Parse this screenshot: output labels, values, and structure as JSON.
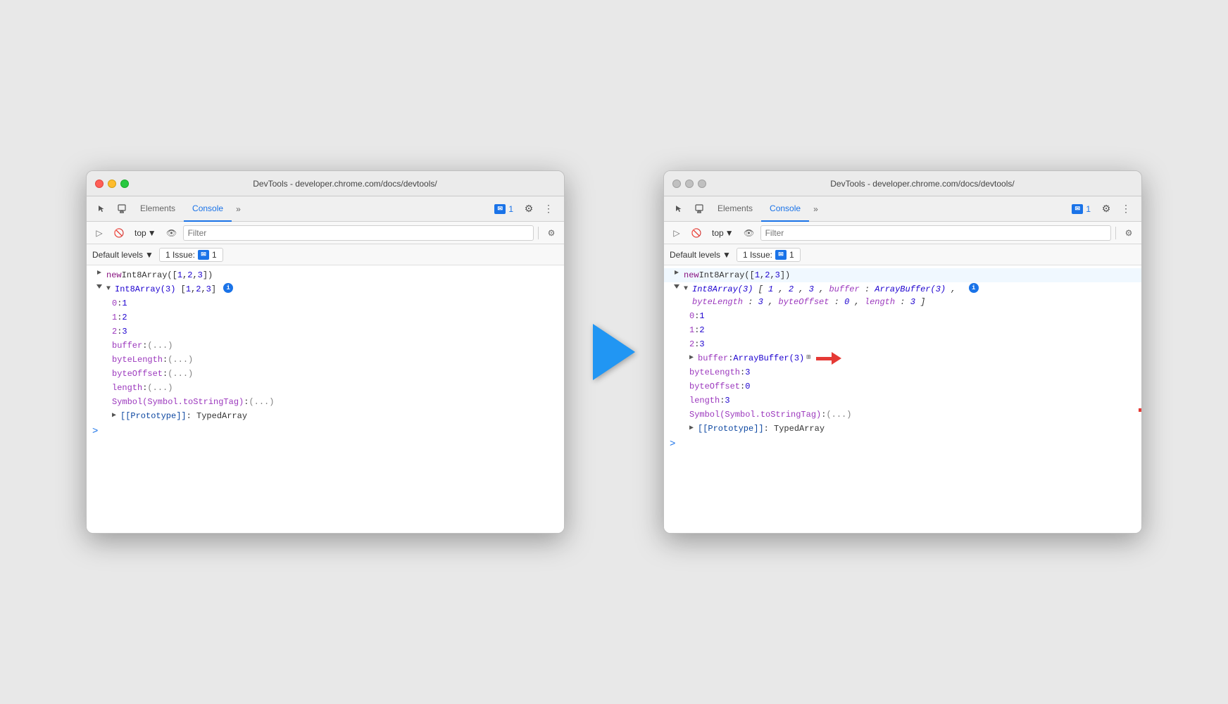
{
  "left_panel": {
    "title": "DevTools - developer.chrome.com/docs/devtools/",
    "tabs": {
      "elements": "Elements",
      "console": "Console",
      "more": "»"
    },
    "badge_count": "1",
    "filter_placeholder": "Filter",
    "default_levels": "Default levels",
    "issues_label": "1 Issue:",
    "issues_count": "1",
    "top_label": "top",
    "console_lines": [
      {
        "type": "input",
        "content": "new Int8Array([1,2,3])"
      },
      {
        "type": "output_header",
        "content": "Int8Array(3) [1, 2, 3]"
      },
      {
        "type": "prop",
        "key": "0",
        "value": "1"
      },
      {
        "type": "prop",
        "key": "1",
        "value": "2"
      },
      {
        "type": "prop",
        "key": "2",
        "value": "3"
      },
      {
        "type": "prop_lazy",
        "key": "buffer",
        "value": "(...)"
      },
      {
        "type": "prop_lazy",
        "key": "byteLength",
        "value": "(...)"
      },
      {
        "type": "prop_lazy",
        "key": "byteOffset",
        "value": "(...)"
      },
      {
        "type": "prop_lazy",
        "key": "length",
        "value": "(...)"
      },
      {
        "type": "prop_symbol",
        "key": "Symbol(Symbol.toStringTag)",
        "value": "(...)"
      },
      {
        "type": "prototype",
        "content": "[[Prototype]]: TypedArray"
      }
    ]
  },
  "right_panel": {
    "title": "DevTools - developer.chrome.com/docs/devtools/",
    "tabs": {
      "elements": "Elements",
      "console": "Console",
      "more": "»"
    },
    "badge_count": "1",
    "filter_placeholder": "Filter",
    "default_levels": "Default levels",
    "issues_label": "1 Issue:",
    "issues_count": "1",
    "top_label": "top",
    "console_lines": [
      {
        "type": "input",
        "content": "new Int8Array([1,2,3])"
      },
      {
        "type": "output_header_expanded",
        "content": "Int8Array(3) [1, 2, 3, buffer: ArrayBuffer(3), byteLength: 3, byteOffset: 0, length: 3]"
      },
      {
        "type": "prop",
        "key": "0",
        "value": "1"
      },
      {
        "type": "prop",
        "key": "1",
        "value": "2"
      },
      {
        "type": "prop",
        "key": "2",
        "value": "3"
      },
      {
        "type": "prop_buffer",
        "key": "buffer",
        "value": "ArrayBuffer(3)"
      },
      {
        "type": "prop_plain",
        "key": "byteLength",
        "value": "3"
      },
      {
        "type": "prop_plain",
        "key": "byteOffset",
        "value": "0"
      },
      {
        "type": "prop_plain",
        "key": "length",
        "value": "3"
      },
      {
        "type": "prop_symbol",
        "key": "Symbol(Symbol.toStringTag)",
        "value": "(...)"
      },
      {
        "type": "prototype",
        "content": "[[Prototype]]: TypedArray"
      }
    ]
  }
}
